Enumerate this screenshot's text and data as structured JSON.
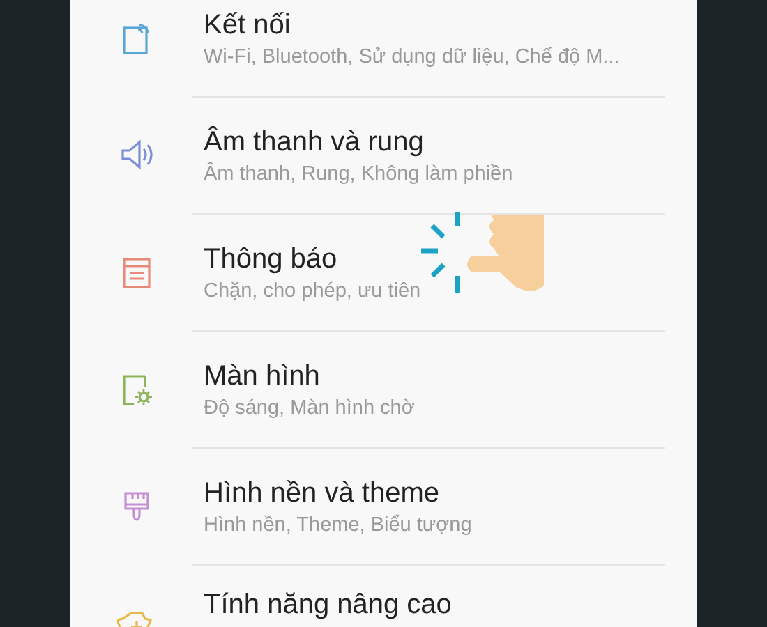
{
  "settings": [
    {
      "kind": "connection",
      "color": "#5aa7d6",
      "title": "Kết nối",
      "subtitle": "Wi-Fi, Bluetooth, Sử dụng dữ liệu, Chế độ M..."
    },
    {
      "kind": "sound",
      "color": "#7b8fd8",
      "title": "Âm thanh và rung",
      "subtitle": "Âm thanh, Rung, Không làm phiền"
    },
    {
      "kind": "notification",
      "color": "#e88a7a",
      "title": "Thông báo",
      "subtitle": "Chặn, cho phép, ưu tiên"
    },
    {
      "kind": "display",
      "color": "#8db35a",
      "title": "Màn hình",
      "subtitle": "Độ sáng, Màn hình chờ"
    },
    {
      "kind": "wallpaper",
      "color": "#c58fd6",
      "title": "Hình nền và theme",
      "subtitle": "Hình nền, Theme, Biểu tượng"
    },
    {
      "kind": "advanced",
      "color": "#e8b84a",
      "title": "Tính năng nâng cao"
    }
  ]
}
